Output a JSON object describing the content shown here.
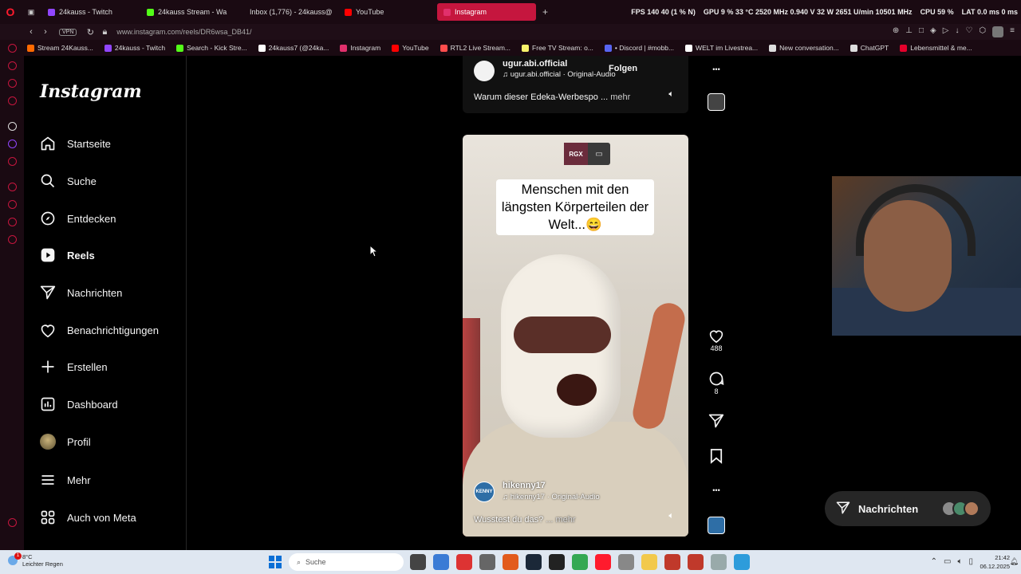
{
  "browser": {
    "tabs": [
      {
        "label": "24kauss - Twitch",
        "color": "#9146ff",
        "active": false
      },
      {
        "label": "24kauss Stream - Wa",
        "color": "#53fc18",
        "active": false
      },
      {
        "label": "Inbox (1,776) - 24kauss@",
        "color": "#ea4335",
        "active": false
      },
      {
        "label": "YouTube",
        "color": "#ff0000",
        "active": false
      },
      {
        "label": "Instagram",
        "color": "#e1306c",
        "active": true
      }
    ],
    "new_tab": "+",
    "perf": {
      "fps": "FPS",
      "fps_val": "140",
      "fps_pct": "40 (1 % N)",
      "gpu": "GPU",
      "gpu_val": "9 %   33 °C   2520 MHz   0.940 V   32 W   2651 U/min   10501 MHz",
      "cpu": "CPU",
      "cpu_val": "59 %",
      "lat": "LAT",
      "lat_val": "0.0 ms   0 ms"
    },
    "url": "www.instagram.com/reels/DR6wsa_DB41/",
    "vpn": "VPN",
    "bookmarks": [
      {
        "label": "Stream 24Kauss...",
        "color": "#ff6a00"
      },
      {
        "label": "24kauss - Twitch",
        "color": "#9146ff"
      },
      {
        "label": "Search - Kick Stre...",
        "color": "#53fc18"
      },
      {
        "label": "24kauss7 (@24ka...",
        "color": "#ffffff"
      },
      {
        "label": "Instagram",
        "color": "#e1306c"
      },
      {
        "label": "YouTube",
        "color": "#ff0000"
      },
      {
        "label": "RTL2 Live Stream...",
        "color": "#ff4d4d"
      },
      {
        "label": "Free TV Stream: o...",
        "color": "#f7f36b"
      },
      {
        "label": "• Discord | #mobb...",
        "color": "#5865f2"
      },
      {
        "label": "WELT im Livestrea...",
        "color": "#ffffff"
      },
      {
        "label": "New conversation...",
        "color": "#dddddd"
      },
      {
        "label": "ChatGPT",
        "color": "#dddddd"
      },
      {
        "label": "Lebensmittel & me...",
        "color": "#e4002b"
      }
    ]
  },
  "instagram": {
    "logo": "Instagram",
    "nav": [
      {
        "label": "Startseite",
        "icon": "home-icon"
      },
      {
        "label": "Suche",
        "icon": "search-icon"
      },
      {
        "label": "Entdecken",
        "icon": "compass-icon"
      },
      {
        "label": "Reels",
        "icon": "reels-icon"
      },
      {
        "label": "Nachrichten",
        "icon": "send-icon"
      },
      {
        "label": "Benachrichtigungen",
        "icon": "heart-icon"
      },
      {
        "label": "Erstellen",
        "icon": "plus-icon"
      },
      {
        "label": "Dashboard",
        "icon": "dashboard-icon"
      },
      {
        "label": "Profil",
        "icon": "profile-avatar-icon"
      },
      {
        "label": "Mehr",
        "icon": "menu-icon"
      },
      {
        "label": "Auch von Meta",
        "icon": "meta-apps-icon"
      }
    ],
    "prev_reel": {
      "user": "ugur.abi.official",
      "audio": "ugur.abi.official · Original-Audio",
      "follow": "Folgen",
      "caption": "Warum dieser Edeka-Werbespo ...",
      "more": "mehr"
    },
    "reel": {
      "badge": "RGX",
      "overlay_text": "Menschen mit den längsten Körperteilen der Welt...😄",
      "avatar_text": "KENNY",
      "user": "hikenny17",
      "audio": "hikenny17 · Original-Audio",
      "caption": "Wusstest du das?",
      "more": "... mehr"
    },
    "actions": {
      "likes": "488",
      "comments": "8"
    },
    "messages_label": "Nachrichten"
  },
  "taskbar": {
    "weather_temp": "8°C",
    "weather_desc": "Leichter Regen",
    "notif_count": "1",
    "search_placeholder": "Suche",
    "time": "21:42",
    "date": "06.12.2025"
  }
}
